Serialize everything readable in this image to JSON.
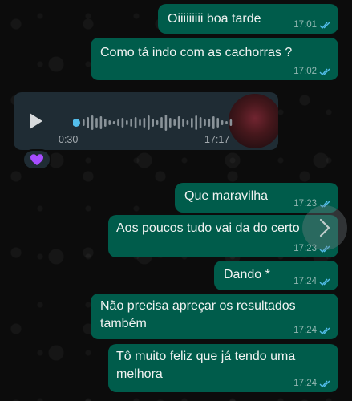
{
  "colors": {
    "outgoing_bubble": "#005c4b",
    "incoming_bubble": "#1f2c34",
    "read_ticks": "#53bdeb",
    "background": "#0c0c0c"
  },
  "messages": [
    {
      "text": "Oiiiiiiiii boa tarde",
      "time": "17:01",
      "status": "read"
    },
    {
      "text": "Como tá indo com as cachorras ?",
      "time": "17:02",
      "status": "read"
    },
    {
      "text": "Que maravilha",
      "time": "17:23",
      "status": "read"
    },
    {
      "text": "Aos poucos tudo vai da do certo",
      "time": "17:23",
      "status": "read"
    },
    {
      "text": "Dando *",
      "time": "17:24",
      "status": "read"
    },
    {
      "lines": [
        "Não precisa apreçar os resultados",
        "também"
      ],
      "time": "17:24",
      "status": "read"
    },
    {
      "lines": [
        "Tô muito feliz que já tendo uma",
        "melhora"
      ],
      "time": "17:24",
      "status": "read"
    }
  ],
  "audio_message": {
    "duration": "0:30",
    "time": "17:17",
    "progress": 0,
    "play_icon": "play-icon"
  },
  "reaction": {
    "emoji": "purple-heart-icon"
  },
  "scroll_button_icon": "chevron-right-icon"
}
